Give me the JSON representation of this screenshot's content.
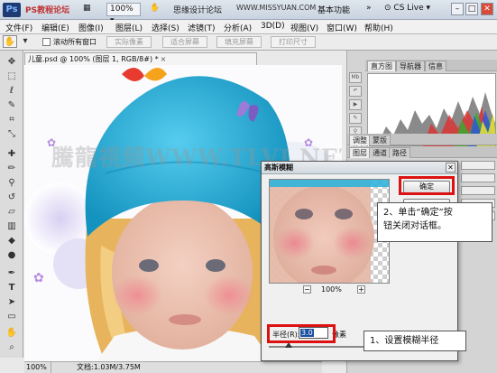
{
  "titlebar": {
    "logo": "Ps",
    "watermark_text": "PS教程论坛",
    "site_text": "思缘设计论坛",
    "site_url": "WWW.MISSYUAN.COM",
    "zoom_value": "100%",
    "workspace": "基本功能",
    "cs_live": "CS Live",
    "min": "–",
    "max": "□",
    "close": "✕"
  },
  "menubar": {
    "items": [
      "文件(F)",
      "编辑(E)",
      "图像(I)",
      "图层(L)",
      "选择(S)",
      "滤镜(T)",
      "分析(A)",
      "3D(D)",
      "视图(V)",
      "窗口(W)",
      "帮助(H)"
    ]
  },
  "options": {
    "scroll_all_label": "滚动所有窗口",
    "buttons": [
      "实际像素",
      "适合屏幕",
      "填充屏幕",
      "打印尺寸"
    ]
  },
  "document": {
    "tab_title": "儿童.psd @ 100% (图层 1, RGB/8#) *",
    "close_glyph": "×",
    "watermark": "騰龍視頻WWW.TLVI.NET",
    "zoom": "100%",
    "doc_info": "文档:1.03M/3.75M"
  },
  "panels": {
    "top_tabs": [
      "直方图",
      "导航器",
      "信息"
    ],
    "mid_tabs": [
      "调整",
      "蒙版"
    ],
    "low_tabs": [
      "图层",
      "通道",
      "路径"
    ]
  },
  "dialog": {
    "title": "高斯模糊",
    "close": "✕",
    "ok_label": "确定",
    "zoom_minus": "−",
    "zoom_value": "100%",
    "zoom_plus": "+",
    "radius_label": "半径(R):",
    "radius_value": "3.0",
    "unit": "像素"
  },
  "annotations": {
    "step1": "1、设置模糊半径",
    "step2_line1": "2、单击“确定”按",
    "step2_line2": "钮关闭对话框。"
  },
  "colors": {
    "highlight": "#dd1111",
    "hat": "#2fb4d6",
    "selection": "#1a4fa0"
  }
}
